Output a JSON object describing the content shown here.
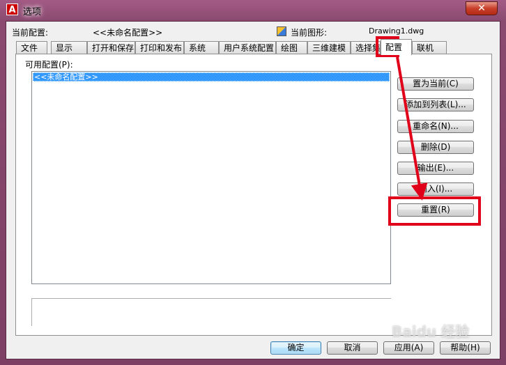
{
  "window": {
    "title": "选项",
    "close_label": "✕"
  },
  "header": {
    "current_profile_label": "当前配置:",
    "current_profile_value": "<<未命名配置>>",
    "current_drawing_label": "当前图形:",
    "current_drawing_value": "Drawing1.dwg"
  },
  "tabs": [
    {
      "label": "文件"
    },
    {
      "label": "显示"
    },
    {
      "label": "打开和保存"
    },
    {
      "label": "打印和发布"
    },
    {
      "label": "系统"
    },
    {
      "label": "用户系统配置"
    },
    {
      "label": "绘图"
    },
    {
      "label": "三维建模"
    },
    {
      "label": "选择集"
    },
    {
      "label": "配置"
    },
    {
      "label": "联机"
    }
  ],
  "profiles": {
    "label": "可用配置(P):",
    "items": [
      "<<未命名配置>>"
    ]
  },
  "side_buttons": {
    "set_current": "置为当前(C)",
    "add_to_list": "添加到列表(L)...",
    "rename": "重命名(N)...",
    "delete": "删除(D)",
    "export": "输出(E)...",
    "import": "输入(I)...",
    "reset": "重置(R)"
  },
  "footer_buttons": {
    "ok": "确定",
    "cancel": "取消",
    "apply": "应用(A)",
    "help": "帮助(H)"
  },
  "annotation": {
    "color": "#e0001a"
  },
  "watermark": {
    "text": "Baidu 经验"
  }
}
